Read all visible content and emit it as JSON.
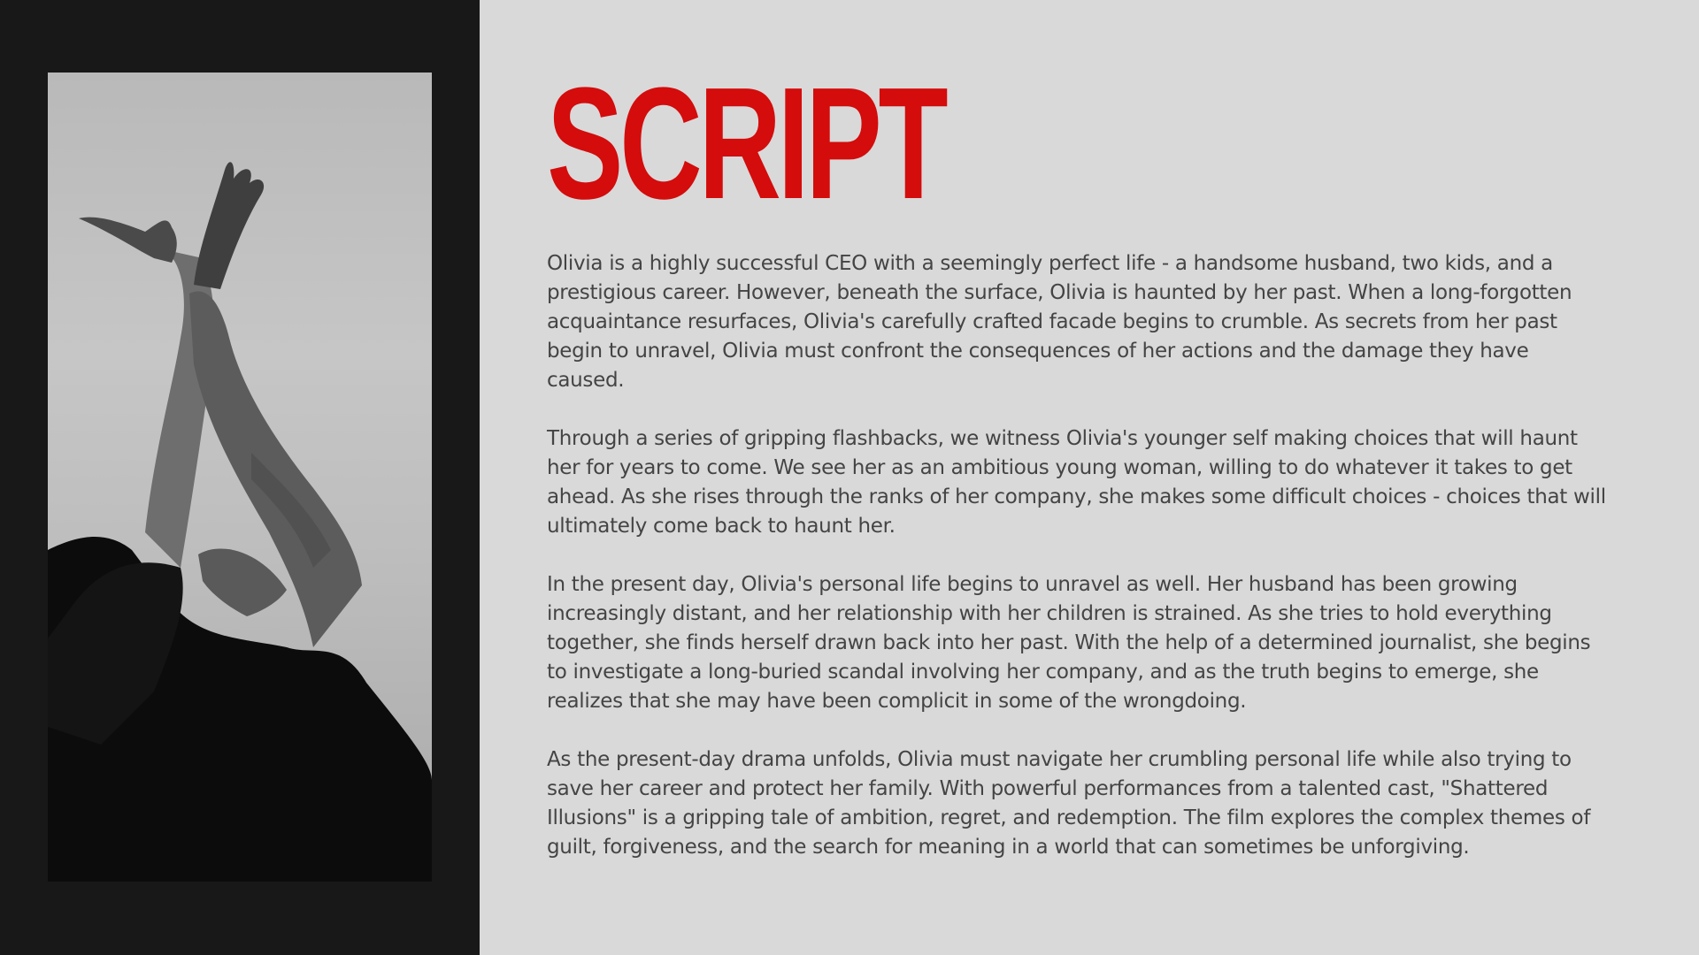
{
  "title": "SCRIPT",
  "colors": {
    "accent": "#d40c0c",
    "left_panel": "#181818",
    "background": "#d9d9d9",
    "body_text": "#444444"
  },
  "paragraphs": [
    "Olivia is a highly successful CEO with a seemingly perfect life - a handsome husband, two kids, and a prestigious career. However, beneath the surface, Olivia is haunted by her past. When a long-forgotten acquaintance resurfaces, Olivia's carefully crafted facade begins to crumble. As secrets from her past begin to unravel, Olivia must confront the consequences of her actions and the damage they have caused.",
    "Through a series of gripping flashbacks, we witness Olivia's younger self making choices that will haunt her for years to come. We see her as an ambitious young woman, willing to do whatever it takes to get ahead. As she rises through the ranks of her company, she makes some difficult choices - choices that will ultimately come back to haunt her.",
    "In the present day, Olivia's personal life begins to unravel as well. Her husband has been growing increasingly distant, and her relationship with her children is strained. As she tries to hold everything together, she finds herself drawn back into her past. With the help of a determined journalist, she begins to investigate a long-buried scandal involving her company, and as the truth begins to emerge, she realizes that she may have been complicit in some of the wrongdoing.",
    "As the present-day drama unfolds, Olivia must navigate her crumbling personal life while also trying to save her career and protect her family. With powerful performances from a talented cast, \"Shattered Illusions\" is a gripping tale of ambition, regret, and redemption. The film explores the complex themes of guilt, forgiveness, and the search for meaning in a world that can sometimes be unforgiving."
  ]
}
